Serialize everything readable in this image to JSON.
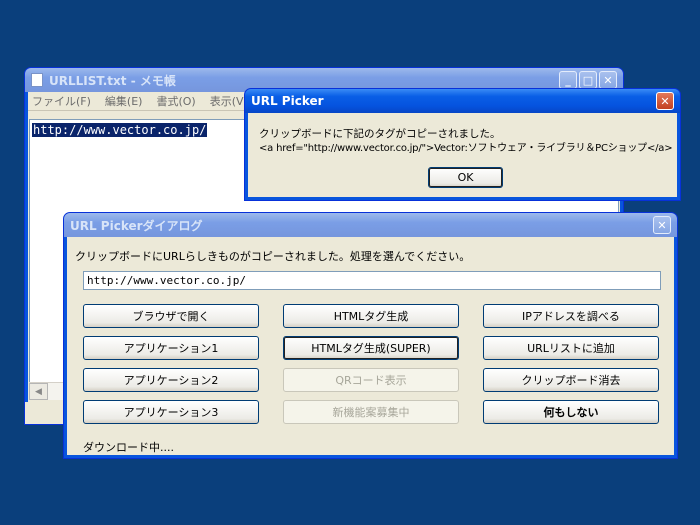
{
  "notepad": {
    "title": "URLLIST.txt - メモ帳",
    "menu": [
      "ファイル(F)",
      "編集(E)",
      "書式(O)",
      "表示(V)"
    ],
    "content": "http://www.vector.co.jp/"
  },
  "picker": {
    "title": "URL Picker",
    "message_line1": "クリップボードに下記のタグがコピーされました。",
    "message_line2": "<a href=\"http://www.vector.co.jp/\">Vector:ソフトウェア・ライブラリ＆PCショップ</a>",
    "ok_label": "OK"
  },
  "dialog": {
    "title": "URL Pickerダイアログ",
    "instruction": "クリップボードにURLらしきものがコピーされました。処理を選んでください。",
    "url_value": "http://www.vector.co.jp/",
    "buttons": {
      "open_browser": "ブラウザで開く",
      "html_tag": "HTMLタグ生成",
      "ip_lookup": "IPアドレスを調べる",
      "app1": "アプリケーション1",
      "html_tag_super": "HTMLタグ生成(SUPER)",
      "add_url_list": "URLリストに追加",
      "app2": "アプリケーション2",
      "qr_code": "QRコード表示",
      "clear_clipboard": "クリップボード消去",
      "app3": "アプリケーション3",
      "new_feature": "新機能案募集中",
      "do_nothing": "何もしない"
    },
    "status": "ダウンロード中...."
  },
  "colors": {
    "desktop": "#0a3f7c",
    "title_active": "#0553df",
    "close_button": "#c2401f"
  }
}
